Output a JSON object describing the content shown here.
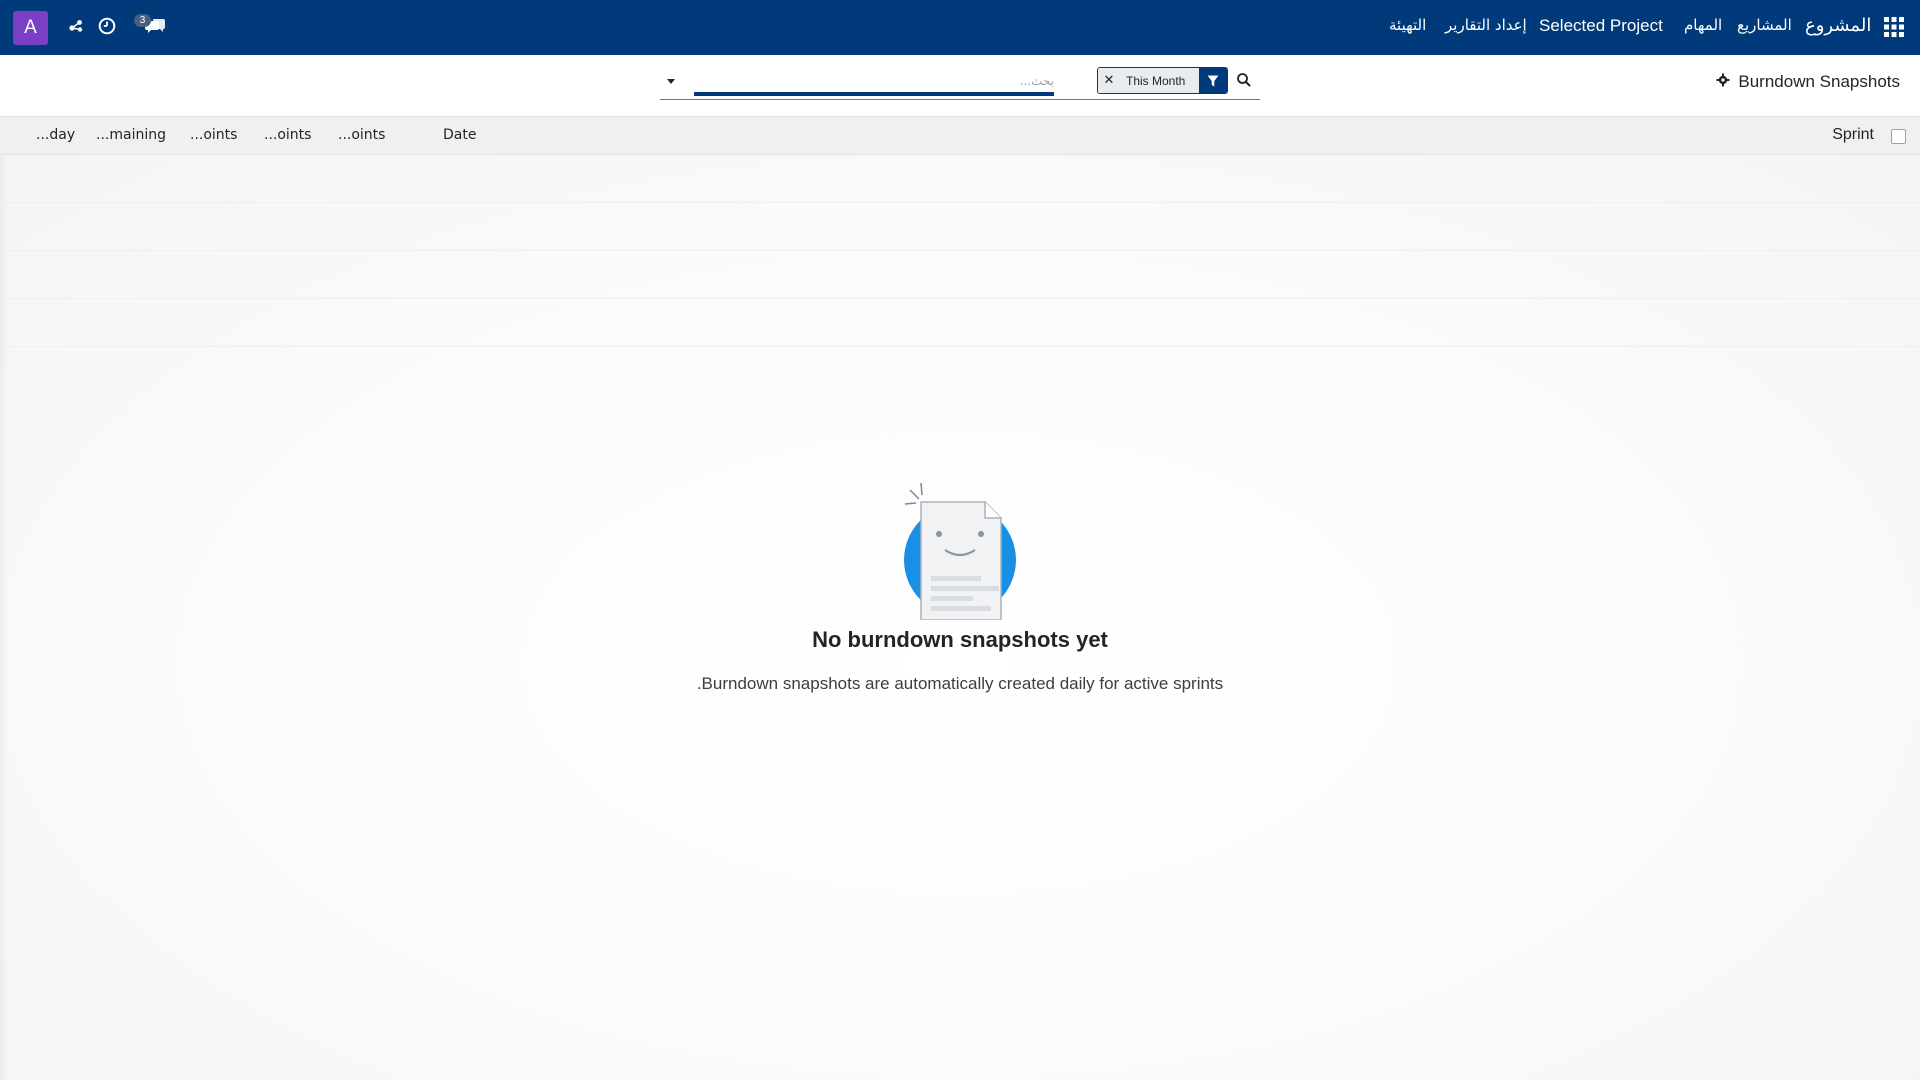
{
  "colors": {
    "navbar": "#013a7a",
    "avatar": "#7a3fc2",
    "header_bg": "#f0f0f0",
    "illustration_blue": "#1a8fe6"
  },
  "navbar": {
    "avatar_letter": "A",
    "messages_badge": "3",
    "icons": [
      "share-icon",
      "clock-icon",
      "chat-icon",
      "apps-grid-icon"
    ],
    "menu": {
      "brand": "المشروع",
      "projects": "المشاريع",
      "tasks": "المهام",
      "selected_project": "Selected Project",
      "reporting": "إعداد التقارير",
      "config": "التهيئة"
    }
  },
  "control_panel": {
    "breadcrumb_icon": "gear-icon",
    "title": "Burndown Snapshots",
    "search": {
      "placeholder": "بحث...",
      "facet_value": "This Month",
      "facet_icon": "filter-icon"
    }
  },
  "list": {
    "columns": {
      "sprint": "Sprint",
      "date": "Date",
      "col1": "...oints",
      "col2": "...oints",
      "col3": "...oints",
      "col4": "...maining",
      "col5": "...day"
    }
  },
  "empty_state": {
    "title": "No burndown snapshots yet",
    "text": ".Burndown snapshots are automatically created daily for active sprints"
  }
}
